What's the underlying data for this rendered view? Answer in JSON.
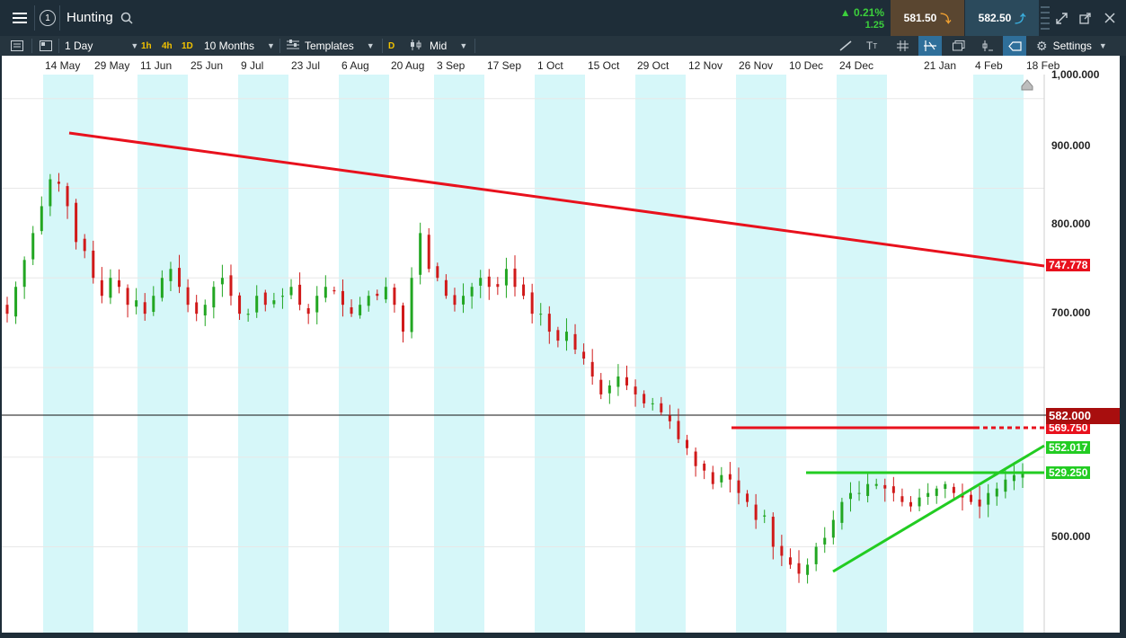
{
  "topbar": {
    "instrument": "Hunting",
    "step_badge": "1",
    "change_pct": "0.21%",
    "change_abs": "1.25",
    "sell_price": "581.50",
    "buy_price": "582.50"
  },
  "toolbar": {
    "interval": "1 Day",
    "quick_intervals": [
      "1h",
      "4h",
      "1D"
    ],
    "range": "10 Months",
    "templates": "Templates",
    "d_chip": "D",
    "price_type": "Mid",
    "settings": "Settings"
  },
  "x_axis": {
    "dates": [
      "14 May",
      "29 May",
      "11 Jun",
      "25 Jun",
      "9 Jul",
      "23 Jul",
      "6 Aug",
      "20 Aug",
      "3 Sep",
      "17 Sep",
      "1 Oct",
      "15 Oct",
      "29 Oct",
      "12 Nov",
      "26 Nov",
      "10 Dec",
      "24 Dec",
      "21 Jan",
      "4 Feb",
      "18 Feb"
    ]
  },
  "y_axis": {
    "labels": [
      "1,000.000",
      "900.000",
      "800.000",
      "700.000",
      "500.000"
    ]
  },
  "price_tags": {
    "current": "582.000",
    "resistance_trend": "747.778",
    "resistance_h": "569.750",
    "support_trend": "552.017",
    "support_h": "529.250"
  },
  "colors": {
    "up": "#22a622",
    "down": "#d01a1a",
    "stripe": "#d6f7f9",
    "red_line": "#e8111d",
    "green_line": "#22cc22",
    "current_tag": "#a80e0e"
  },
  "chart_data": {
    "type": "candlestick",
    "series": [
      {
        "name": "Hunting",
        "close": [
          760,
          790,
          820,
          850,
          880,
          910,
          905,
          880,
          840,
          830,
          800,
          780,
          800,
          790,
          770,
          775,
          760,
          780,
          800,
          810,
          790,
          770,
          760,
          770,
          790,
          800,
          780,
          760,
          760,
          780,
          770,
          775,
          780,
          790,
          770,
          760,
          780,
          790,
          785,
          770,
          760,
          770,
          780,
          780,
          790,
          770,
          740,
          800,
          850,
          810,
          800,
          780,
          770,
          780,
          790,
          800,
          790,
          790,
          810,
          790,
          780,
          760,
          760,
          740,
          730,
          740,
          720,
          710,
          690,
          670,
          680,
          690,
          680,
          670,
          660,
          660,
          650,
          640,
          620,
          610,
          590,
          585,
          570,
          580,
          575,
          560,
          550,
          530,
          535,
          500,
          490,
          480,
          470,
          480,
          500,
          510,
          530,
          550,
          560,
          560,
          570,
          570,
          565,
          560,
          550,
          545,
          555,
          560,
          565,
          570,
          560,
          555,
          550,
          545,
          560,
          565,
          575,
          580,
          582
        ]
      },
      {
        "name": "resistance-trend",
        "points": [
          [
            "14 May",
            915
          ],
          [
            "18 Feb",
            747.778
          ]
        ]
      },
      {
        "name": "resistance-h",
        "value": 569.75
      },
      {
        "name": "support-trend",
        "points": [
          [
            "24 Dec",
            466
          ],
          [
            "18 Feb",
            552.017
          ]
        ]
      },
      {
        "name": "support-h",
        "value": 529.25
      }
    ],
    "ylim": [
      450,
      1000
    ],
    "current_price": 582.0,
    "grid": true
  }
}
